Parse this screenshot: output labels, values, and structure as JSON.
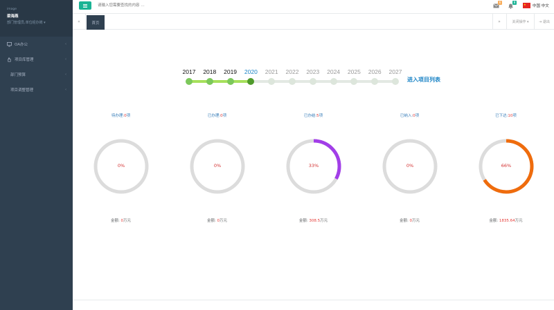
{
  "sidebar": {
    "img_label": "image",
    "user_name": "梁海燕",
    "dept": "部门管理员,单位经办岗",
    "items": [
      {
        "label": "OA办公"
      },
      {
        "label": "项目库管理"
      },
      {
        "label": "部门预算"
      },
      {
        "label": "项目调整管理"
      }
    ]
  },
  "topbar": {
    "search_placeholder": "请输入您需要查找的内容 …",
    "mail_badge": "6",
    "bell_badge": "8",
    "lang": "中国 中文"
  },
  "tabs": {
    "home": "首页",
    "close_ops": "关闭操作",
    "exit": "退出"
  },
  "timeline": {
    "years": [
      "2017",
      "2018",
      "2019",
      "2020",
      "2021",
      "2022",
      "2023",
      "2024",
      "2025",
      "2026",
      "2027"
    ],
    "active_year": "2020",
    "enter_link": "进入项目列表"
  },
  "stats": [
    {
      "label": "待办理:",
      "count": "0",
      "unit": "项",
      "percent": 0,
      "pct_text": "0%",
      "amount_label": "金额:",
      "amount": "0",
      "amount_unit": "万元",
      "color": "#dcdcdc"
    },
    {
      "label": "已办理:",
      "count": "0",
      "unit": "项",
      "percent": 0,
      "pct_text": "0%",
      "amount_label": "金额:",
      "amount": "0",
      "amount_unit": "万元",
      "color": "#dcdcdc"
    },
    {
      "label": "已办结:",
      "count": "5",
      "unit": "项",
      "percent": 0.33,
      "pct_text": "33%",
      "amount_label": "金额:",
      "amount": "308.5",
      "amount_unit": "万元",
      "color": "#a23ee8"
    },
    {
      "label": "已纳入:",
      "count": "0",
      "unit": "项",
      "percent": 0,
      "pct_text": "0%",
      "amount_label": "金额:",
      "amount": "0",
      "amount_unit": "万元",
      "color": "#dcdcdc"
    },
    {
      "label": "已下达:",
      "count": "10",
      "unit": "项",
      "percent": 0.66,
      "pct_text": "66%",
      "amount_label": "金额:",
      "amount": "1835.64",
      "amount_unit": "万元",
      "color": "#ef6c0d"
    }
  ]
}
